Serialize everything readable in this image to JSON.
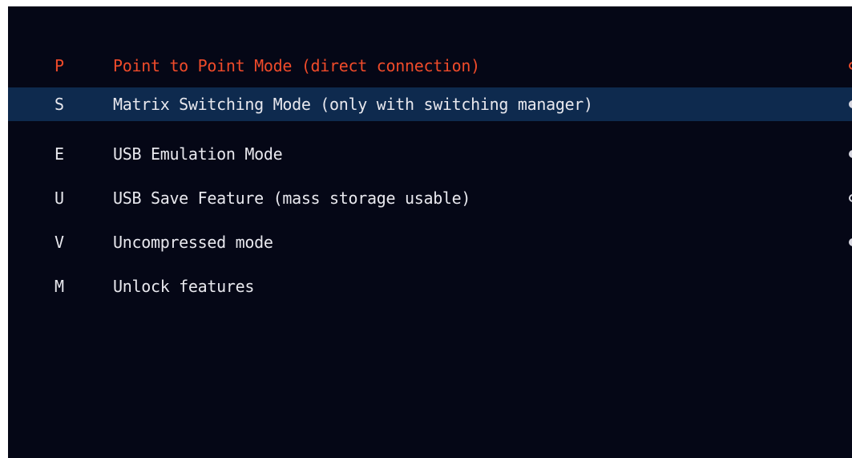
{
  "menu": {
    "items": [
      {
        "key": "P",
        "label": "Point to Point Mode (direct connection)",
        "status": "off"
      },
      {
        "key": "S",
        "label": "Matrix Switching Mode (only with switching manager)",
        "status": "on"
      },
      {
        "key": "E",
        "label": "USB Emulation Mode",
        "status": "on"
      },
      {
        "key": "U",
        "label": "USB Save Feature (mass storage usable)",
        "status": "off"
      },
      {
        "key": "V",
        "label": "Uncompressed mode",
        "status": "on"
      },
      {
        "key": "M",
        "label": "Unlock features",
        "status": "none"
      }
    ],
    "active_index": 0,
    "selected_index": 1
  },
  "colors": {
    "background": "#050716",
    "highlight": "#0e2a4e",
    "active_text": "#f04b2a",
    "text": "#e8e8ee"
  }
}
